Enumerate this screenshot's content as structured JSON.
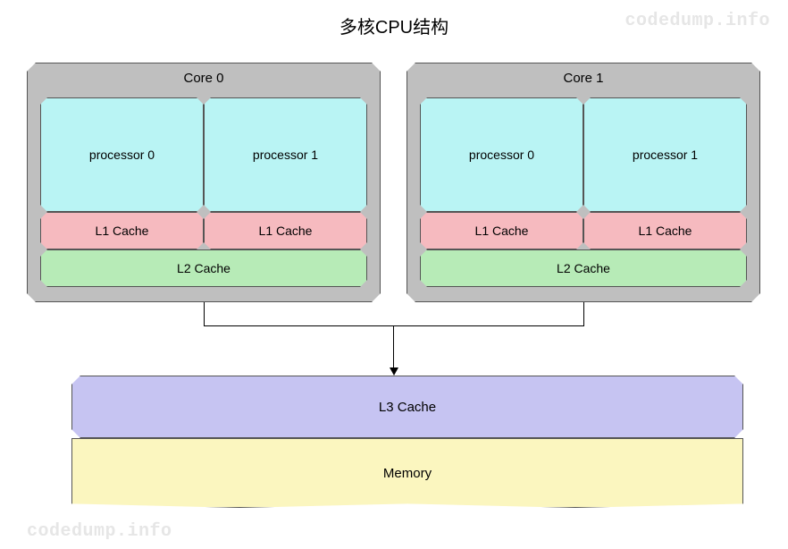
{
  "title": "多核CPU结构",
  "watermark": "codedump.info",
  "cores": [
    {
      "title": "Core 0",
      "processors": [
        "processor 0",
        "processor 1"
      ],
      "l1": [
        "L1 Cache",
        "L1 Cache"
      ],
      "l2": "L2 Cache"
    },
    {
      "title": "Core 1",
      "processors": [
        "processor 0",
        "processor 1"
      ],
      "l1": [
        "L1 Cache",
        "L1 Cache"
      ],
      "l2": "L2 Cache"
    }
  ],
  "l3": "L3 Cache",
  "memory": "Memory",
  "colors": {
    "core_bg": "#bfbfbf",
    "processor": "#b9f4f4",
    "l1": "#f6babf",
    "l2": "#b7ebb7",
    "l3": "#c6c4f2",
    "memory": "#fbf6bf"
  }
}
